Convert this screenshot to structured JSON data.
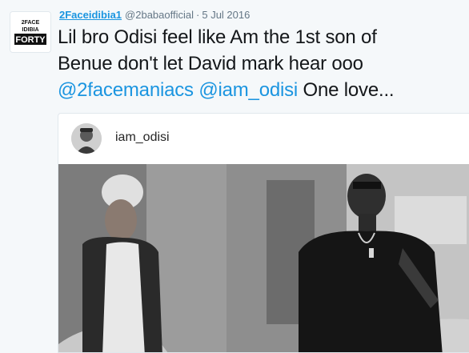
{
  "tweet": {
    "display_name": "2Faceidibia1",
    "handle": "@2babaofficial",
    "separator": "·",
    "date": "5 Jul 2016",
    "text_parts": {
      "line1": "Lil bro Odisi feel like Am the 1st son of",
      "line2": "Benue  don't let David mark hear ooo",
      "mention1": "@2facemaniacs",
      "mention2": "@iam_odisi",
      "tail": " One love..."
    },
    "avatar_logo_text": "2FACE IDIBIA FORTY"
  },
  "embed": {
    "username": "iam_odisi"
  }
}
